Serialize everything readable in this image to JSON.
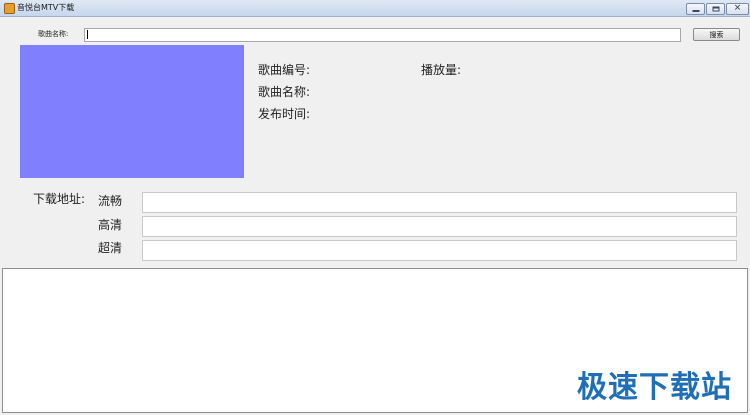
{
  "window": {
    "title": "音悦台MTV下载",
    "controls": {
      "minimize": "minimize-icon",
      "maximize": "maximize-icon",
      "close": "close-icon"
    }
  },
  "search": {
    "label": "歌曲名称:",
    "value": "",
    "button_label": "搜索"
  },
  "cover": {
    "color": "#8080ff"
  },
  "info": {
    "song_id_label": "歌曲编号:",
    "play_count_label": "播放量:",
    "song_name_label": "歌曲名称:",
    "release_time_label": "发布时间:"
  },
  "download": {
    "label": "下载地址:",
    "rows": [
      {
        "quality": "流畅",
        "url": ""
      },
      {
        "quality": "高清",
        "url": ""
      },
      {
        "quality": "超清",
        "url": ""
      }
    ]
  },
  "log": {
    "text": ""
  },
  "watermark": {
    "text": "极速下载站"
  }
}
